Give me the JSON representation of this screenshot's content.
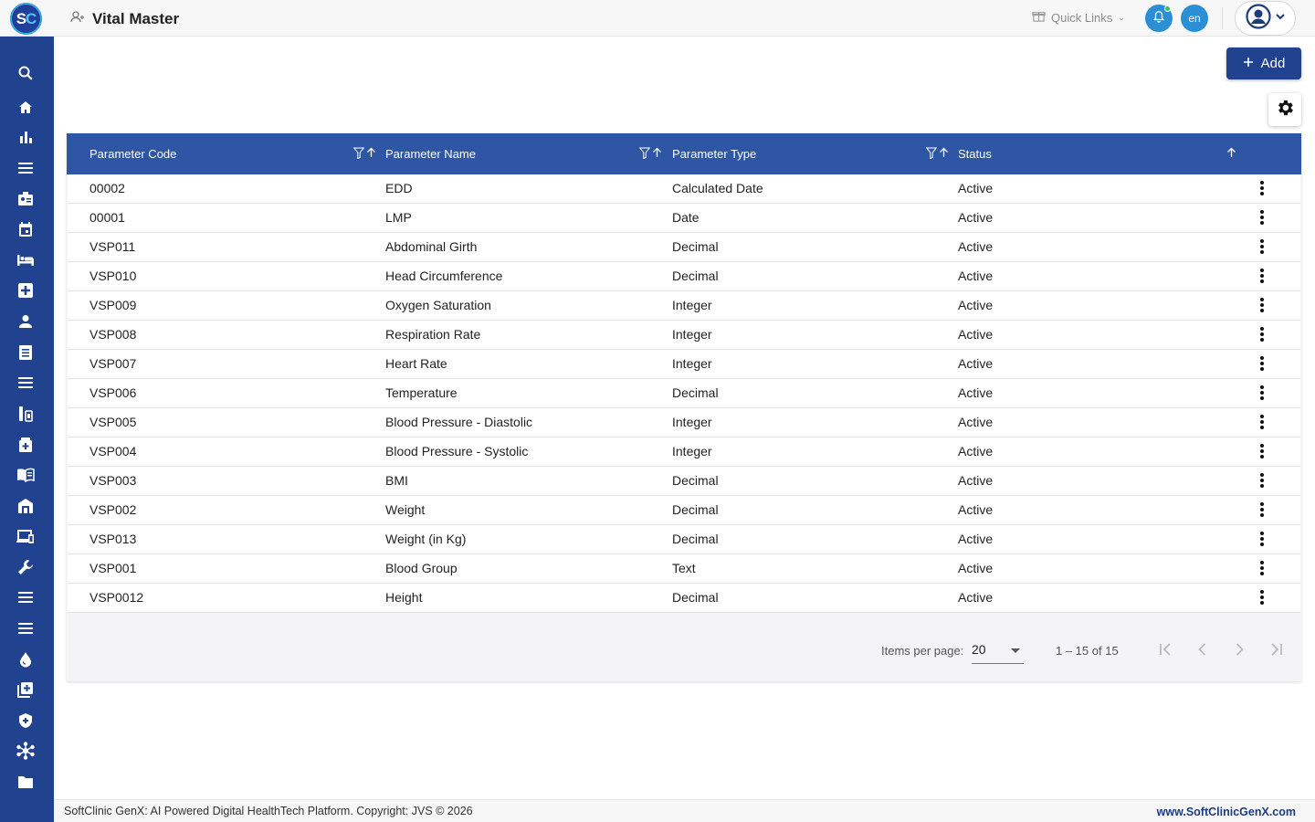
{
  "app": {
    "logo_text_s": "S",
    "logo_text_c": "C",
    "page_title": "Vital Master"
  },
  "header": {
    "quick_links_label": "Quick Links",
    "language_code": "en",
    "notification_dot_color": "#37c15a",
    "accent_color": "#2a8fd4"
  },
  "sidebar": {
    "background": "#21438f",
    "items": [
      {
        "icon": "search-icon"
      },
      {
        "icon": "home-icon"
      },
      {
        "icon": "bar-chart-icon"
      },
      {
        "icon": "list-icon"
      },
      {
        "icon": "badge-icon"
      },
      {
        "icon": "calendar-icon"
      },
      {
        "icon": "bed-icon"
      },
      {
        "icon": "medical-plus-icon"
      },
      {
        "icon": "person-icon"
      },
      {
        "icon": "document-icon"
      },
      {
        "icon": "list-icon"
      },
      {
        "icon": "lab-icon"
      },
      {
        "icon": "pharmacy-icon"
      },
      {
        "icon": "book-icon"
      },
      {
        "icon": "store-icon"
      },
      {
        "icon": "devices-icon"
      },
      {
        "icon": "wrench-icon"
      },
      {
        "icon": "list-icon"
      },
      {
        "icon": "list-icon"
      },
      {
        "icon": "blood-drop-icon"
      },
      {
        "icon": "add-library-icon"
      },
      {
        "icon": "shield-icon"
      },
      {
        "icon": "hub-icon"
      },
      {
        "icon": "folder-icon"
      }
    ]
  },
  "toolbar": {
    "add_label": "Add"
  },
  "table": {
    "columns": [
      "Parameter Code",
      "Parameter Name",
      "Parameter Type",
      "Status"
    ],
    "rows": [
      [
        "00002",
        "EDD",
        "Calculated Date",
        "Active"
      ],
      [
        "00001",
        "LMP",
        "Date",
        "Active"
      ],
      [
        "VSP011",
        "Abdominal Girth",
        "Decimal",
        "Active"
      ],
      [
        "VSP010",
        "Head Circumference",
        "Decimal",
        "Active"
      ],
      [
        "VSP009",
        "Oxygen Saturation",
        "Integer",
        "Active"
      ],
      [
        "VSP008",
        "Respiration Rate",
        "Integer",
        "Active"
      ],
      [
        "VSP007",
        "Heart Rate",
        "Integer",
        "Active"
      ],
      [
        "VSP006",
        "Temperature",
        "Decimal",
        "Active"
      ],
      [
        "VSP005",
        "Blood Pressure - Diastolic",
        "Integer",
        "Active"
      ],
      [
        "VSP004",
        "Blood Pressure - Systolic",
        "Integer",
        "Active"
      ],
      [
        "VSP003",
        "BMI",
        "Decimal",
        "Active"
      ],
      [
        "VSP002",
        "Weight",
        "Decimal",
        "Active"
      ],
      [
        "VSP013",
        "Weight (in Kg)",
        "Decimal",
        "Active"
      ],
      [
        "VSP001",
        "Blood Group",
        "Text",
        "Active"
      ],
      [
        "VSP0012",
        "Height",
        "Decimal",
        "Active"
      ]
    ]
  },
  "paginator": {
    "items_per_page_label": "Items per page:",
    "items_per_page_value": "20",
    "range_label": "1 – 15 of 15"
  },
  "footer": {
    "copyright": "SoftClinic GenX: AI Powered Digital HealthTech Platform. Copyright: JVS © 2026",
    "website": "www.SoftClinicGenX.com"
  }
}
